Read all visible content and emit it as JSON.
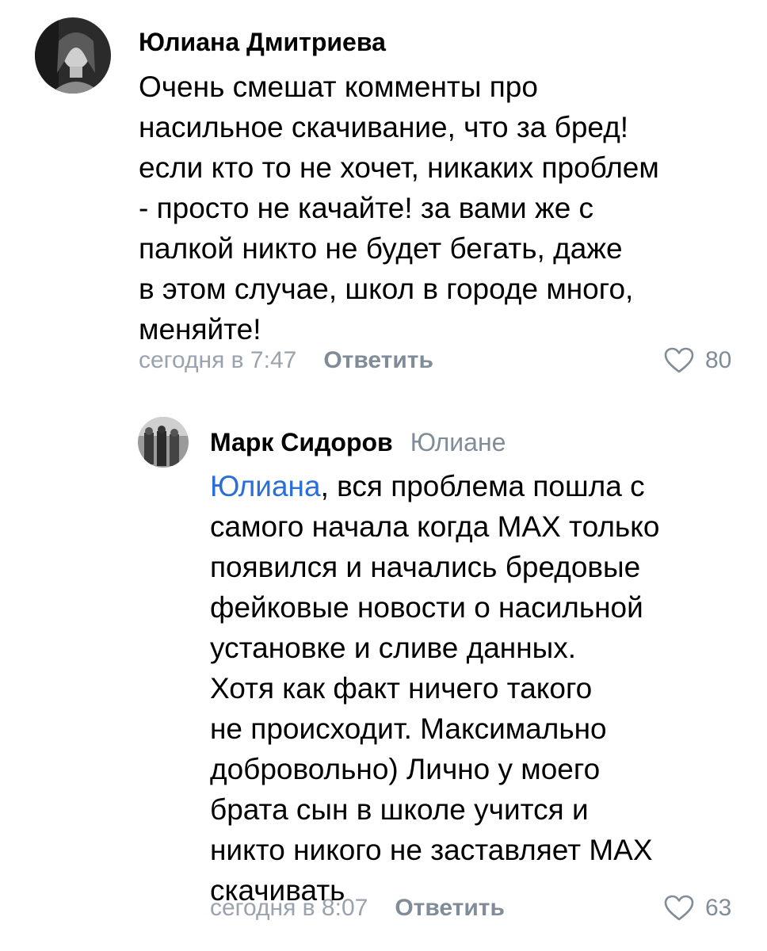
{
  "comments": [
    {
      "author": "Юлиана Дмитриева",
      "avatar_icon": "user-photo-avatar",
      "text_lines": [
        "Очень смешат комменты про",
        "насильное скачивание, что за бред!",
        "если кто то не хочет, никаких проблем",
        "- просто не качайте! за вами же с",
        "палкой никто не будет бегать, даже",
        "в этом случае, школ в городе много,",
        "меняйте!"
      ],
      "time": "сегодня в 7:47",
      "reply_label": "Ответить",
      "likes": "80"
    },
    {
      "author": "Марк Сидоров",
      "reply_to": "Юлиане",
      "avatar_icon": "user-photo-avatar",
      "mention": "Юлиана",
      "first_line_rest": ", вся проблема пошла с",
      "text_lines": [
        "самого начала когда MAX только",
        "появился и начались бредовые",
        "фейковые новости о насильной",
        "установке и сливе данных.",
        "Хотя как факт ничего такого",
        "не происходит. Максимально",
        "добровольно) Лично у моего",
        "брата сын в школе учится и",
        "никто никого не заставляет MAX",
        "скачивать"
      ],
      "time": "сегодня в 8:07",
      "reply_label": "Ответить",
      "likes": "63"
    }
  ],
  "colors": {
    "mention": "#2a6fd6",
    "meta": "#99a2ad",
    "secondary": "#818c99"
  }
}
